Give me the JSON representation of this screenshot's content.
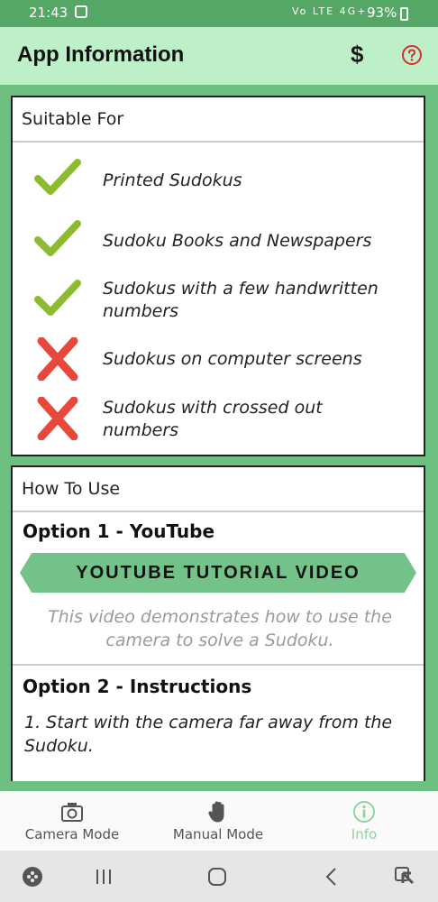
{
  "status": {
    "time": "21:43",
    "network": "Vo LTE 4G+",
    "battery": "93%"
  },
  "appbar": {
    "title": "App Information",
    "dollar": "$"
  },
  "suitable": {
    "header": "Suitable For",
    "items": [
      {
        "label": "Printed Sudokus",
        "ok": true
      },
      {
        "label": "Sudoku Books and Newspapers",
        "ok": true
      },
      {
        "label": "Sudokus with a few handwritten numbers",
        "ok": true
      },
      {
        "label": "Sudokus on computer screens",
        "ok": false
      },
      {
        "label": "Sudokus with crossed out numbers",
        "ok": false
      }
    ]
  },
  "howto": {
    "header": "How To Use",
    "option1_title": "Option 1 - YouTube",
    "youtube_button": "YOUTUBE TUTORIAL VIDEO",
    "youtube_note": "This video demonstrates how to use the camera to solve a Sudoku.",
    "option2_title": "Option 2 - Instructions",
    "step1": "1. Start with the camera far away from the Sudoku."
  },
  "bottomnav": {
    "camera": "Camera Mode",
    "manual": "Manual Mode",
    "info": "Info"
  },
  "colors": {
    "accent": "#73c28a",
    "check": "#8dbb2e",
    "cross": "#e8473b",
    "help": "#d32f2f",
    "info_active": "#8fd49e"
  }
}
